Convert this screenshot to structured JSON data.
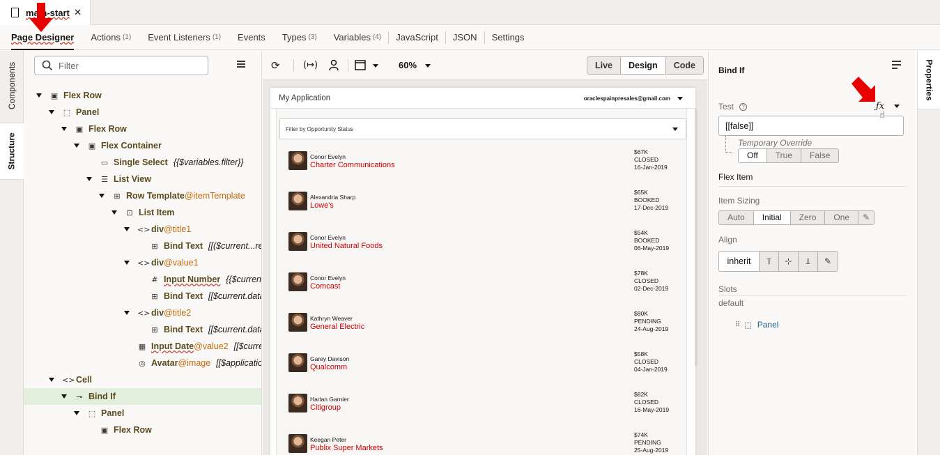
{
  "file_tab": {
    "title": "main-start"
  },
  "designer_tabs": [
    {
      "label": "Page Designer",
      "count": "",
      "active": true
    },
    {
      "label": "Actions",
      "count": "(1)"
    },
    {
      "label": "Event Listeners",
      "count": "(1)"
    },
    {
      "label": "Events",
      "count": ""
    },
    {
      "label": "Types",
      "count": "(3)"
    },
    {
      "label": "Variables",
      "count": "(4)"
    },
    {
      "label": "JavaScript",
      "count": ""
    },
    {
      "label": "JSON",
      "count": ""
    },
    {
      "label": "Settings",
      "count": ""
    }
  ],
  "left_rail": {
    "components": "Components",
    "structure": "Structure"
  },
  "structure": {
    "filter_placeholder": "Filter",
    "rows": [
      {
        "name": "Flex Row",
        "id": "",
        "expr": "",
        "icon": "▣",
        "level": 0,
        "caret": true
      },
      {
        "name": "Panel",
        "id": "",
        "expr": "",
        "icon": "⬚",
        "level": 1,
        "caret": true
      },
      {
        "name": "Flex Row",
        "id": "",
        "expr": "",
        "icon": "▣",
        "level": 2,
        "caret": true
      },
      {
        "name": "Flex Container",
        "id": "",
        "expr": "",
        "icon": "▣",
        "level": 3,
        "caret": true
      },
      {
        "name": "Single Select",
        "id": "",
        "expr": "{{$variables.filter}}",
        "icon": "▭",
        "level": 4,
        "caret": false
      },
      {
        "name": "List View",
        "id": "",
        "expr": "",
        "icon": "☰",
        "level": 4,
        "caret": true
      },
      {
        "name": "Row Template",
        "id": "@itemTemplate",
        "expr": "",
        "icon": "⊞",
        "level": 5,
        "caret": true
      },
      {
        "name": "List Item",
        "id": "",
        "expr": "",
        "icon": "⊡",
        "level": 6,
        "caret": true
      },
      {
        "name": "div",
        "id": "@title1",
        "expr": "",
        "icon": "<>",
        "level": 7,
        "caret": true
      },
      {
        "name": "Bind Text",
        "id": "",
        "expr": "[[($current...rep",
        "icon": "⊞",
        "level": 8,
        "caret": false
      },
      {
        "name": "div",
        "id": "@value1",
        "expr": "",
        "icon": "<>",
        "level": 7,
        "caret": true
      },
      {
        "name": "Input Number",
        "id": "",
        "expr": "{{$current",
        "icon": "#",
        "level": 8,
        "caret": false,
        "underline": true
      },
      {
        "name": "Bind Text",
        "id": "",
        "expr": "[[$current.data",
        "icon": "⊞",
        "level": 8,
        "caret": false
      },
      {
        "name": "div",
        "id": "@title2",
        "expr": "",
        "icon": "<>",
        "level": 7,
        "caret": true
      },
      {
        "name": "Bind Text",
        "id": "",
        "expr": "[[$current.data",
        "icon": "⊞",
        "level": 8,
        "caret": false
      },
      {
        "name": "Input Date",
        "id": "@value2",
        "expr": "[[$curre",
        "icon": "▦",
        "level": 7,
        "caret": false,
        "underline": true
      },
      {
        "name": "Avatar",
        "id": "@image",
        "expr": "[[$applicatio",
        "icon": "◎",
        "level": 7,
        "caret": false
      },
      {
        "name": "Cell",
        "id": "",
        "expr": "",
        "icon": "<>",
        "level": 1,
        "caret": true
      },
      {
        "name": "Bind If",
        "id": "",
        "expr": "",
        "icon": "⊸",
        "level": 2,
        "caret": true,
        "selected": true
      },
      {
        "name": "Panel",
        "id": "",
        "expr": "",
        "icon": "⬚",
        "level": 3,
        "caret": true
      },
      {
        "name": "Flex Row",
        "id": "",
        "expr": "",
        "icon": "▣",
        "level": 4,
        "caret": false
      }
    ]
  },
  "canvas_toolbar": {
    "zoom": "60%",
    "modes": [
      {
        "label": "Live",
        "on": false
      },
      {
        "label": "Design",
        "on": true
      },
      {
        "label": "Code",
        "on": false
      }
    ]
  },
  "preview": {
    "app_title": "My Application",
    "user": "oraclespainpresales@gmail.com",
    "filter_placeholder": "Filter by Opportunity Status",
    "items": [
      {
        "person": "Conor Evelyn",
        "company": "Charter Communications",
        "amount": "$67K",
        "status": "CLOSED",
        "date": "16-Jan-2019"
      },
      {
        "person": "Alexandria Sharp",
        "company": "Lowe's",
        "amount": "$65K",
        "status": "BOOKED",
        "date": "17-Dec-2019"
      },
      {
        "person": "Conor Evelyn",
        "company": "United Natural Foods",
        "amount": "$54K",
        "status": "BOOKED",
        "date": "06-May-2019"
      },
      {
        "person": "Conor Evelyn",
        "company": "Comcast",
        "amount": "$78K",
        "status": "CLOSED",
        "date": "02-Dec-2019"
      },
      {
        "person": "Kathryn Weaver",
        "company": "General Electric",
        "amount": "$80K",
        "status": "PENDING",
        "date": "24-Aug-2019"
      },
      {
        "person": "Garey Davison",
        "company": "Qualcomm",
        "amount": "$58K",
        "status": "CLOSED",
        "date": "04-Jan-2019"
      },
      {
        "person": "Harlan Garnier",
        "company": "Citigroup",
        "amount": "$82K",
        "status": "CLOSED",
        "date": "16-May-2019"
      },
      {
        "person": "Keegan Peter",
        "company": "Publix Super Markets",
        "amount": "$74K",
        "status": "PENDING",
        "date": "25-Aug-2019"
      }
    ]
  },
  "properties": {
    "rail_label": "Properties",
    "title": "Bind If",
    "test_label": "Test",
    "fx_label": "ƒx",
    "test_value": "[[false]]",
    "temporary_override_label": "Temporary Override",
    "override_options": [
      {
        "label": "Off",
        "on": true
      },
      {
        "label": "True",
        "on": false
      },
      {
        "label": "False",
        "on": false
      }
    ],
    "flex_item_label": "Flex Item",
    "item_sizing_label": "Item Sizing",
    "item_sizing_options": [
      {
        "label": "Auto",
        "on": false
      },
      {
        "label": "Initial",
        "on": true
      },
      {
        "label": "Zero",
        "on": false
      },
      {
        "label": "One",
        "on": false
      }
    ],
    "align_label": "Align",
    "align_value": "inherit",
    "slots_label": "Slots",
    "slot_default_label": "default",
    "slot_panel_label": "Panel"
  },
  "colors": {
    "accent_red": "#e60000",
    "link_blue": "#1b5c87",
    "company_red": "#cc0000",
    "selected_row": "#e1efdc"
  }
}
